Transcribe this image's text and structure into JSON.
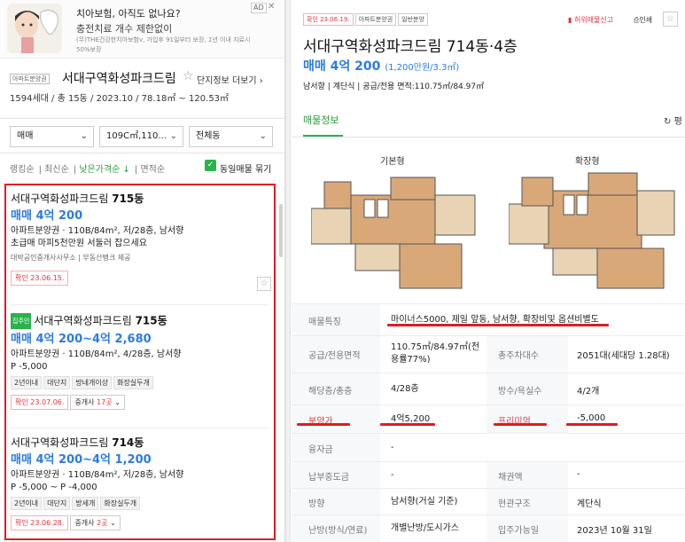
{
  "ad": {
    "title": "치아보험, 아직도 없나요?",
    "subtitle": "충전치료 개수 제한없이",
    "fine": "(무)THE건강한치아보험v, 가입후 91일부터 보장, 1년 이내 지료시 50%보장",
    "badge": "AD",
    "close": "✕"
  },
  "complex": {
    "tag": "아파트분양권",
    "name": "서대구역화성파크드림",
    "more": "단지정보 더보기",
    "info": "1594세대 / 총 15동 / 2023.10 / 78.18㎡ ~ 120.53㎡"
  },
  "filters": {
    "trade": "매매",
    "area": "109C㎡,110...",
    "dong": "전체동"
  },
  "sort": {
    "ranking": "랭킹순",
    "latest": "최신순",
    "low_price": "낮은가격순 ↓",
    "area": "면적순",
    "same_label": "동일매물 묶기"
  },
  "listings": [
    {
      "name": "서대구역화성파크드림",
      "dong": "715동",
      "price": "매매 4억 200",
      "desc": "아파트분양권 · 110B/84m², 저/28층, 남서향",
      "note": "초급매 마피5천만원 서둘러 잡으세요",
      "agency": "대박공인중개사사무소 | 부동산뱅크 제공",
      "confirm": "확인 23.06.15."
    },
    {
      "badge": "집주인",
      "name": "서대구역화성파크드림",
      "dong": "715동",
      "price": "매매 4억 200~4억 2,680",
      "desc": "아파트분양권 · 110B/84m², 4/28층, 남서향",
      "note": "P -5,000",
      "tags": [
        "2년이내",
        "대단지",
        "방네개이상",
        "화장실두개"
      ],
      "confirm": "확인 23.07.06.",
      "broker_pre": "중개사",
      "broker_num": "17곳"
    },
    {
      "name": "서대구역화성파크드림",
      "dong": "714동",
      "price": "매매 4억 200~4억 1,200",
      "desc": "아파트분양권 · 110B/84m², 저/28층, 남서향",
      "note": "P -5,000 ~ P -4,000",
      "tags": [
        "2년이내",
        "대단지",
        "방세개",
        "화장실두개"
      ],
      "confirm": "확인 23.06.28.",
      "broker_pre": "중개사",
      "broker_num": "2곳"
    }
  ],
  "detail": {
    "confirm": "확인 23.06.19.",
    "tag1": "아파트분양권",
    "tag2": "일반분양",
    "report": "허위매물신고",
    "print": "인쇄",
    "title": "서대구역화성파크드림 714동·4층",
    "price": "매매 4억 200",
    "price_unit": "(1,200만원/3.3㎡)",
    "meta": "남서향 | 계단식 | 공급/전용 면적:110.75㎡/84.97㎡",
    "tab": "매물정보",
    "refresh": "평",
    "fp_basic": "기본형",
    "fp_extended": "확장형",
    "rows": [
      {
        "k1": "매물특징",
        "v1": "마이너스5000, 제일 앞동, 남서향, 확장비및 옵션비별도"
      },
      {
        "k1": "공급/전용면적",
        "v1": "110.75㎡/84.97㎡(전용률77%)",
        "k2": "총주차대수",
        "v2": "2051대(세대당 1.28대)"
      },
      {
        "k1": "해당층/총층",
        "v1": "4/28층",
        "k2": "방수/욕실수",
        "v2": "4/2개"
      },
      {
        "k1": "분양가",
        "v1": "4억5,200",
        "k2": "프리미엄",
        "v2": "-5,000"
      },
      {
        "k1": "융자금",
        "v1": "-"
      },
      {
        "k1": "납부중도금",
        "v1": "-",
        "k2": "채권액",
        "v2": "-"
      },
      {
        "k1": "방향",
        "v1": "남서향(거실 기준)",
        "k2": "현관구조",
        "v2": "계단식"
      },
      {
        "k1": "난방(방식/연료)",
        "v1": "개별난방/도시가스",
        "k2": "입주가능일",
        "v2": "2023년 10월 31일"
      }
    ]
  }
}
